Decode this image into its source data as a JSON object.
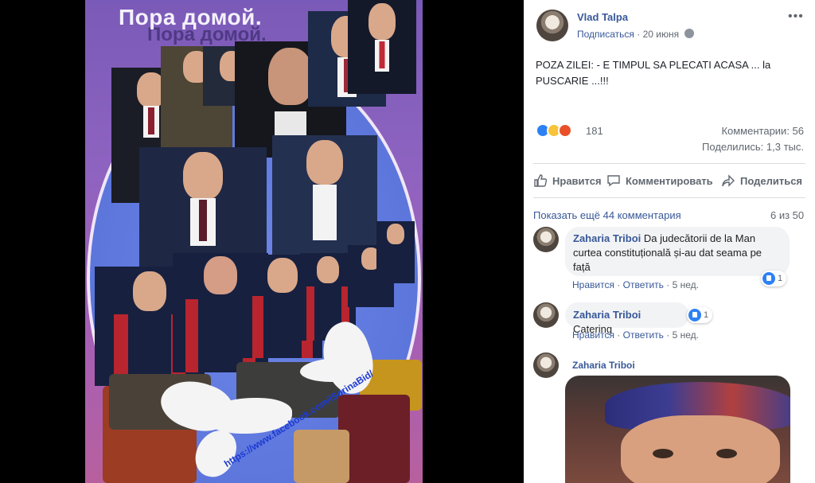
{
  "photo": {
    "title": "Пора домой.",
    "title_shadow": "Пора домой.",
    "watermark": "https://www.facebook.com/lSorinaBid/"
  },
  "post": {
    "author": "Vlad Talpa",
    "subscribe_label": "Подписаться",
    "date": "20 июня",
    "text": "POZA ZILEI: - E TIMPUL SA PLECATI ACASA ... la PUSCARIE ...!!!",
    "reactions_count": "181",
    "comments_count": "Комментарии: 56",
    "shares_count": "Поделились: 1,3 тыс.",
    "actions": {
      "like": "Нравится",
      "comment": "Комментировать",
      "share": "Поделиться"
    }
  },
  "comments_header": {
    "more_label": "Показать ещё 44 комментария",
    "page_count": "6 из 50"
  },
  "comments": [
    {
      "author": "Zaharia Triboi",
      "text": "Da judecătorii de la Man curtea constituțională și-au dat seama pe față",
      "like_label": "Нравится",
      "reply_label": "Ответить",
      "age": "5 нед.",
      "reaction_count": "1"
    },
    {
      "author": "Zaharia Triboi",
      "text": "Catering",
      "like_label": "Нравится",
      "reply_label": "Ответить",
      "age": "5 нед.",
      "reaction_count": "1"
    },
    {
      "author": "Zaharia Triboi"
    }
  ],
  "colors": {
    "link": "#385898",
    "like_blue": "#2e81f4",
    "haha_yellow": "#f7c33a",
    "angry_orange": "#e9502a",
    "viewer_bg": "#000000"
  },
  "icons": [
    "globe-icon",
    "more-dots-icon",
    "like-icon",
    "comment-icon",
    "share-icon"
  ]
}
